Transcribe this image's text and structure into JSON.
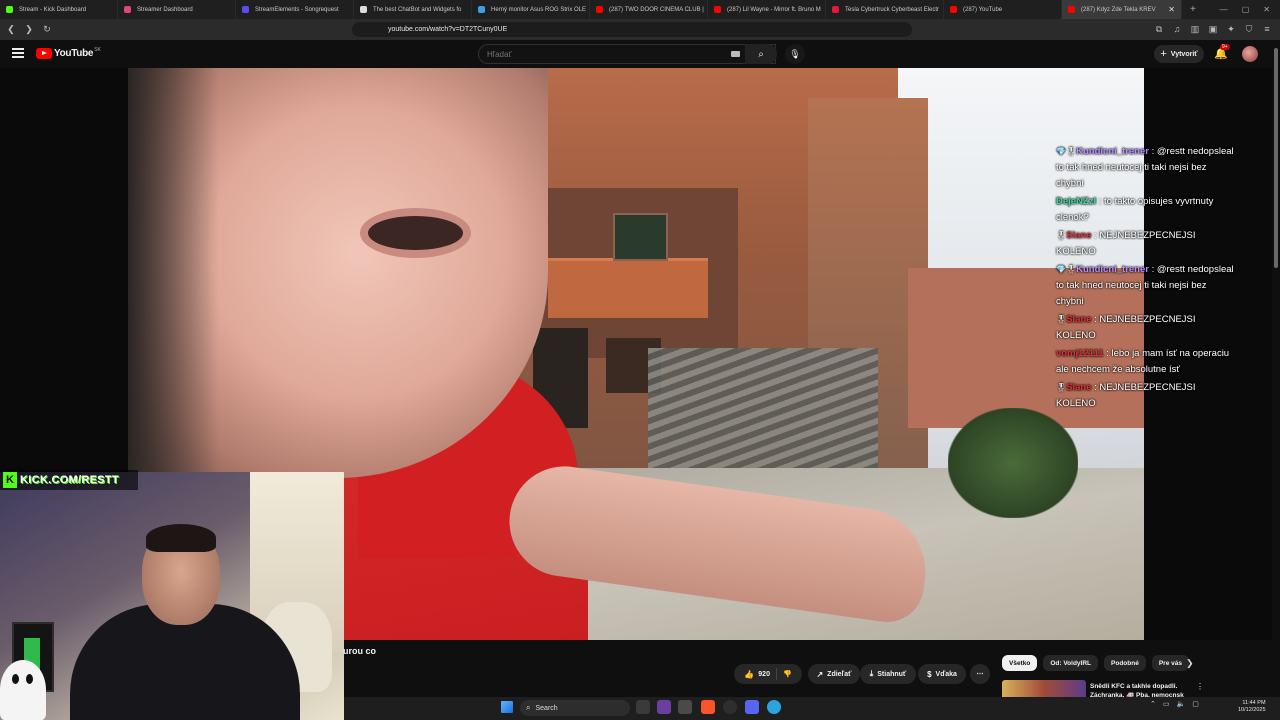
{
  "browser": {
    "tabs": [
      {
        "label": "Stream - Kick Dashboard",
        "color": "#53fc18"
      },
      {
        "label": "Streamer Dashboard",
        "color": "#e0457b"
      },
      {
        "label": "StreamElements - Songrequest",
        "color": "#5a4bf5"
      },
      {
        "label": "The best ChatBot and Widgets fo",
        "color": "#dddddd"
      },
      {
        "label": "Herný monitor Asus ROG Strix OLE",
        "color": "#3aa0e6"
      },
      {
        "label": "(287) TWO DOOR CINEMA CLUB |",
        "color": "#ff0000"
      },
      {
        "label": "(287) Lil Wayne - Mirror ft. Bruno M",
        "color": "#ff0000"
      },
      {
        "label": "Tesla Cybertruck Cyberbeast Electr",
        "color": "#e31937"
      },
      {
        "label": "(287) YouTube",
        "color": "#ff0000"
      },
      {
        "label": "(287) Kdyz Zde Tekla KREV",
        "color": "#ff0000",
        "active": true
      }
    ],
    "url": "youtube.com/watch?v=DT2TCuny0UE"
  },
  "youtube": {
    "logo_text": "YouTube",
    "country_code": "SK",
    "search_placeholder": "Hľadať",
    "create_label": "Vytvoriť",
    "notification_count": "9+"
  },
  "overlay": {
    "kick_url": "KICK.COM/RESTT",
    "chat": [
      {
        "user": "Kundicni_trener",
        "color": "#b48cff",
        "text": " : @restt nedopsleal to tak hned neutocej ti taki nejsi bez chybni"
      },
      {
        "user": "DejeNZzI",
        "color": "#3ad6a0",
        "text": " : to takto opisujes vyvrtnuty clenok?"
      },
      {
        "user": "Slane",
        "color": "#e0303a",
        "text": " : NEJNEBEZPECNEJSI KOLENO"
      },
      {
        "user": "Kundicni_trener",
        "color": "#b48cff",
        "text": " : @restt nedopsleal to tak hned neutocej ti taki nejsi bez chybni"
      },
      {
        "user": "Slane",
        "color": "#e0303a",
        "text": " : NEJNEBEZPECNEJSI KOLENO"
      },
      {
        "user": "vomj12111",
        "color": "#e0303a",
        "text": " : lebo ja mam ísť na operaciu ale nechcem že absolutne ísť"
      },
      {
        "user": "Slane",
        "color": "#e0303a",
        "text": " : NEJNEBEZPECNEJSI KOLENO"
      }
    ]
  },
  "video": {
    "title_fragment": "urou co",
    "like_count": "920",
    "share_label": "Zdieľať",
    "download_label": "Stiahnuť",
    "thanks_label": "Vďaka"
  },
  "right_rail": {
    "chips": [
      "Všetko",
      "Od: VoldyIRL",
      "Podobné",
      "Pre vás"
    ],
    "rec_title": "Snědli KFC a takhle dopadli. Záchranka, 🚑 Pba, nemocnsk"
  },
  "taskbar": {
    "search_label": "Search",
    "time": "11:44 PM",
    "date": "10/12/2025"
  }
}
